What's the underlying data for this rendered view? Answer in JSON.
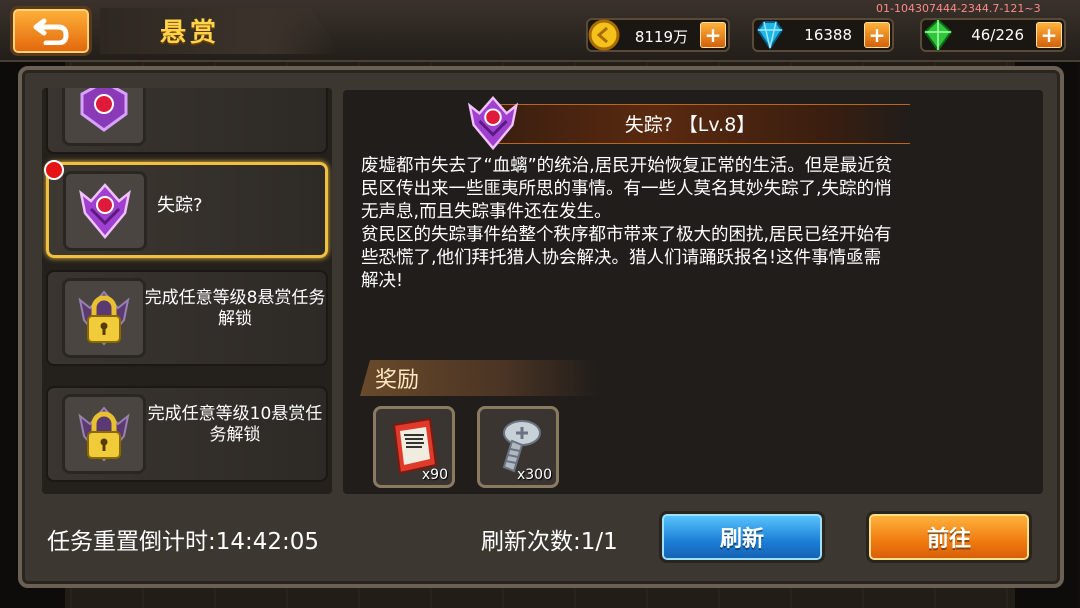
{
  "header": {
    "title": "悬赏",
    "debug_id": "01-104307444-2344.7-121~3",
    "resources": [
      {
        "name": "gold",
        "value": "8119万",
        "color": "#f4c21a"
      },
      {
        "name": "diamond",
        "value": "16388",
        "color": "#1fb6e8"
      },
      {
        "name": "energy",
        "value": "46/226",
        "color": "#2fc63a"
      }
    ],
    "plus_label": "+"
  },
  "quest_list": {
    "items": [
      {
        "name": "",
        "state": "partial"
      },
      {
        "name": "失踪?",
        "state": "selected"
      },
      {
        "name": "完成任意等级8悬赏任务解锁",
        "state": "locked"
      },
      {
        "name": "完成任意等级10悬赏任务解锁",
        "state": "locked"
      }
    ]
  },
  "detail": {
    "title": "失踪? 【Lv.8】",
    "description_lines": [
      "废墟都市失去了“血螭”的统治,居民开始恢复正常的生活。但是最近贫",
      "民区传出来一些匪夷所思的事情。有一些人莫名其妙失踪了,失踪的悄",
      "无声息,而且失踪事件还在发生。",
      "贫民区的失踪事件给整个秩序都市带来了极大的困扰,居民已经开始有",
      "些恐慌了,他们拜托猎人协会解决。猎人们请踊跃报名!这件事情亟需",
      "解决!"
    ],
    "reward_label": "奖励",
    "rewards": [
      {
        "icon": "ticket-icon",
        "qty": "x90"
      },
      {
        "icon": "screw-icon",
        "qty": "x300"
      }
    ]
  },
  "footer": {
    "timer_label": "任务重置倒计时:14:42:05",
    "refresh_count_label": "刷新次数:1/1",
    "refresh_button": "刷新",
    "go_button": "前往"
  }
}
